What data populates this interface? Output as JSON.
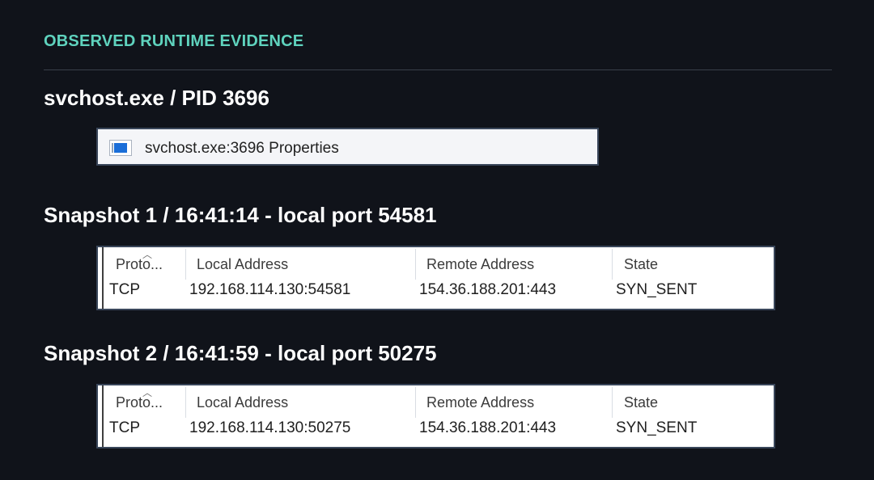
{
  "header": {
    "section_title": "OBSERVED RUNTIME EVIDENCE"
  },
  "process": {
    "heading": "svchost.exe / PID 3696",
    "window_title": "svchost.exe:3696 Properties",
    "window_icon": "application-window-icon"
  },
  "snapshots": [
    {
      "heading": "Snapshot 1 / 16:41:14 - local port 54581",
      "columns": [
        "Proto...",
        "Local Address",
        "Remote Address",
        "State"
      ],
      "row": {
        "proto": "TCP",
        "local": "192.168.114.130:54581",
        "remote": "154.36.188.201:443",
        "state": "SYN_SENT"
      }
    },
    {
      "heading": "Snapshot 2 / 16:41:59 - local port 50275",
      "columns": [
        "Proto...",
        "Local Address",
        "Remote Address",
        "State"
      ],
      "row": {
        "proto": "TCP",
        "local": "192.168.114.130:50275",
        "remote": "154.36.188.201:443",
        "state": "SYN_SENT"
      }
    }
  ],
  "colors": {
    "background": "#10131a",
    "accent": "#5fd3be",
    "panel_border": "#39465a"
  }
}
